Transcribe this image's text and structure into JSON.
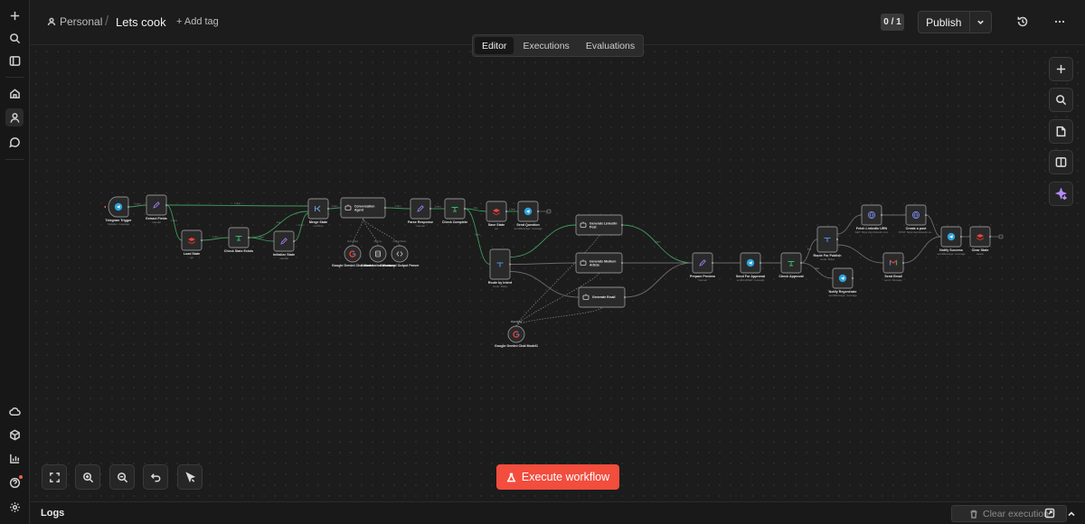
{
  "header": {
    "project": "Personal",
    "workflow_name": "Lets cook",
    "add_tag": "+ Add tag",
    "version_counter": "0 / 1",
    "publish_label": "Publish"
  },
  "tabs": [
    {
      "label": "Editor",
      "active": true
    },
    {
      "label": "Executions",
      "active": false
    },
    {
      "label": "Evaluations",
      "active": false
    }
  ],
  "execute_label": "Execute workflow",
  "logs": {
    "label": "Logs",
    "clear_label": "Clear execution"
  },
  "colors": {
    "accent": "#f24d3d",
    "canvas_bg": "#1c1c1c",
    "node_bg": "#2a2a2a",
    "success_edge": "#3e9b5c"
  },
  "rail_icons": [
    "plus-icon",
    "search-icon",
    "sidebar-icon",
    "home-icon",
    "user-icon",
    "chat-icon",
    "cloud-icon",
    "templates-icon",
    "insights-icon",
    "help-icon",
    "settings-icon"
  ],
  "nodes": [
    {
      "id": "trigger",
      "title": "Telegram Trigger",
      "sub": "Updates: message",
      "icon": "telegram",
      "trigger": true
    },
    {
      "id": "extract",
      "title": "Extract Fields",
      "sub": "manual",
      "icon": "pen"
    },
    {
      "id": "load",
      "title": "Load State",
      "sub": "get",
      "icon": "redis"
    },
    {
      "id": "checkstate",
      "title": "Check State Exists",
      "sub": "",
      "icon": "if"
    },
    {
      "id": "init",
      "title": "Initialize State",
      "sub": "manual",
      "icon": "pen"
    },
    {
      "id": "merge",
      "title": "Merge State",
      "sub": "combine",
      "icon": "merge"
    },
    {
      "id": "agent",
      "title": "Conversation Agent",
      "sub": "",
      "icon": "robot"
    },
    {
      "id": "gemini1",
      "title": "Google Gemini Chat Model",
      "sub": "",
      "icon": "google"
    },
    {
      "id": "memory",
      "title": "Conversation Memory",
      "sub": "",
      "icon": "db"
    },
    {
      "id": "parser",
      "title": "Structured Output Parser",
      "sub": "",
      "icon": "code"
    },
    {
      "id": "parse",
      "title": "Parse Response",
      "sub": "manual",
      "icon": "pen"
    },
    {
      "id": "checkcomplete",
      "title": "Check Complete",
      "sub": "",
      "icon": "if"
    },
    {
      "id": "save",
      "title": "Save State",
      "sub": "set",
      "icon": "redis"
    },
    {
      "id": "question",
      "title": "Send Question",
      "sub": "sendMessage: message",
      "icon": "telegram"
    },
    {
      "id": "route",
      "title": "Route by Intent",
      "sub": "mode: Rules",
      "icon": "switch"
    },
    {
      "id": "linkedin",
      "title": "Generate LinkedIn Post",
      "sub": "",
      "icon": "robot"
    },
    {
      "id": "medium",
      "title": "Generate Medium Article",
      "sub": "",
      "icon": "robot"
    },
    {
      "id": "email",
      "title": "Generate Email",
      "sub": "",
      "icon": "robot"
    },
    {
      "id": "gemini2",
      "title": "Google Gemini Chat Model1",
      "sub": "",
      "icon": "google"
    },
    {
      "id": "preview",
      "title": "Prepare Preview",
      "sub": "manual",
      "icon": "pen"
    },
    {
      "id": "approval",
      "title": "Send For Approval",
      "sub": "sendAndWait: message",
      "icon": "telegram"
    },
    {
      "id": "checkapproval",
      "title": "Check Approval",
      "sub": "",
      "icon": "if"
    },
    {
      "id": "routepublish",
      "title": "Route For Publish",
      "sub": "mode: Rules",
      "icon": "switch"
    },
    {
      "id": "fetch",
      "title": "Fetch LinkedIn URN",
      "sub": "GET: https://api.linkedin.com",
      "icon": "globe"
    },
    {
      "id": "post",
      "title": "Create a post",
      "sub": "POST: https://api.linkedin.co...",
      "icon": "globe"
    },
    {
      "id": "sendemail",
      "title": "Send Email",
      "sub": "send: message",
      "icon": "gmail"
    },
    {
      "id": "regenerate",
      "title": "Notify Regenerate",
      "sub": "sendMessage: message",
      "icon": "telegram"
    },
    {
      "id": "success",
      "title": "Notify Success",
      "sub": "sendMessage: message",
      "icon": "telegram"
    },
    {
      "id": "clear",
      "title": "Clear State",
      "sub": "delete",
      "icon": "redis"
    }
  ],
  "edge_labels": {
    "item": "1 item",
    "true": "true",
    "false": "false",
    "chat_model": "Chat Model",
    "memory": "Memory",
    "output_parser": "Output Parser"
  }
}
